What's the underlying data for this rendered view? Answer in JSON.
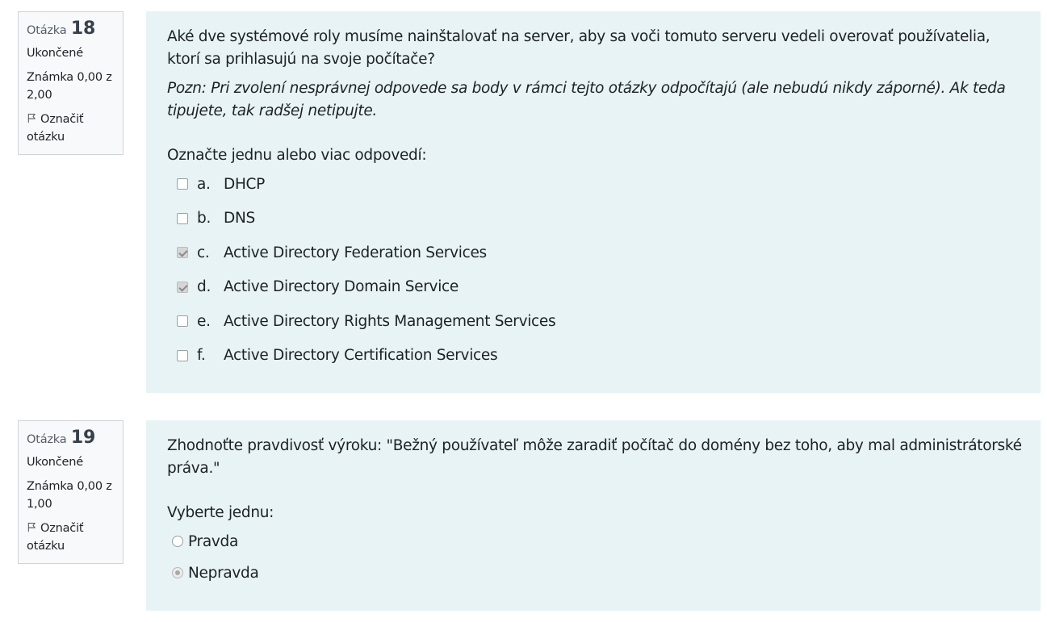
{
  "questions": [
    {
      "info": {
        "label": "Otázka",
        "number": "18",
        "state": "Ukončené",
        "grade": "Známka 0,00 z 2,00",
        "flag": "Označiť otázku"
      },
      "text": "Aké dve systémové roly musíme nainštalovať na server, aby sa voči tomuto serveru vedeli overovať používatelia, ktorí sa prihlasujú na svoje počítače?",
      "note": "Pozn: Pri zvolení nesprávnej odpovede sa body v rámci tejto otázky odpočítajú (ale nebudú nikdy záporné). Ak teda tipujete, tak radšej netipujte.",
      "prompt": "Označte jednu alebo viac odpovedí:",
      "answers": [
        {
          "letter": "a.",
          "text": "DHCP",
          "checked": false
        },
        {
          "letter": "b.",
          "text": "DNS",
          "checked": false
        },
        {
          "letter": "c.",
          "text": "Active Directory Federation Services",
          "checked": true
        },
        {
          "letter": "d.",
          "text": "Active Directory Domain Service",
          "checked": true
        },
        {
          "letter": "e.",
          "text": "Active Directory Rights Management Services",
          "checked": false
        },
        {
          "letter": "f.",
          "text": "Active Directory Certification Services",
          "checked": false
        }
      ]
    },
    {
      "info": {
        "label": "Otázka",
        "number": "19",
        "state": "Ukončené",
        "grade": "Známka 0,00 z 1,00",
        "flag": "Označiť otázku"
      },
      "text": "Zhodnoťte pravdivosť výroku: \"Bežný používateľ môže zaradiť počítač do domény bez toho, aby mal administrátorské práva.\"",
      "prompt": "Vyberte jednu:",
      "answers": [
        {
          "text": "Pravda",
          "checked": false
        },
        {
          "text": "Nepravda",
          "checked": true
        }
      ]
    }
  ],
  "icons": {
    "flag": "flag-icon",
    "checkbox": "checkbox-icon",
    "radio": "radio-icon"
  }
}
